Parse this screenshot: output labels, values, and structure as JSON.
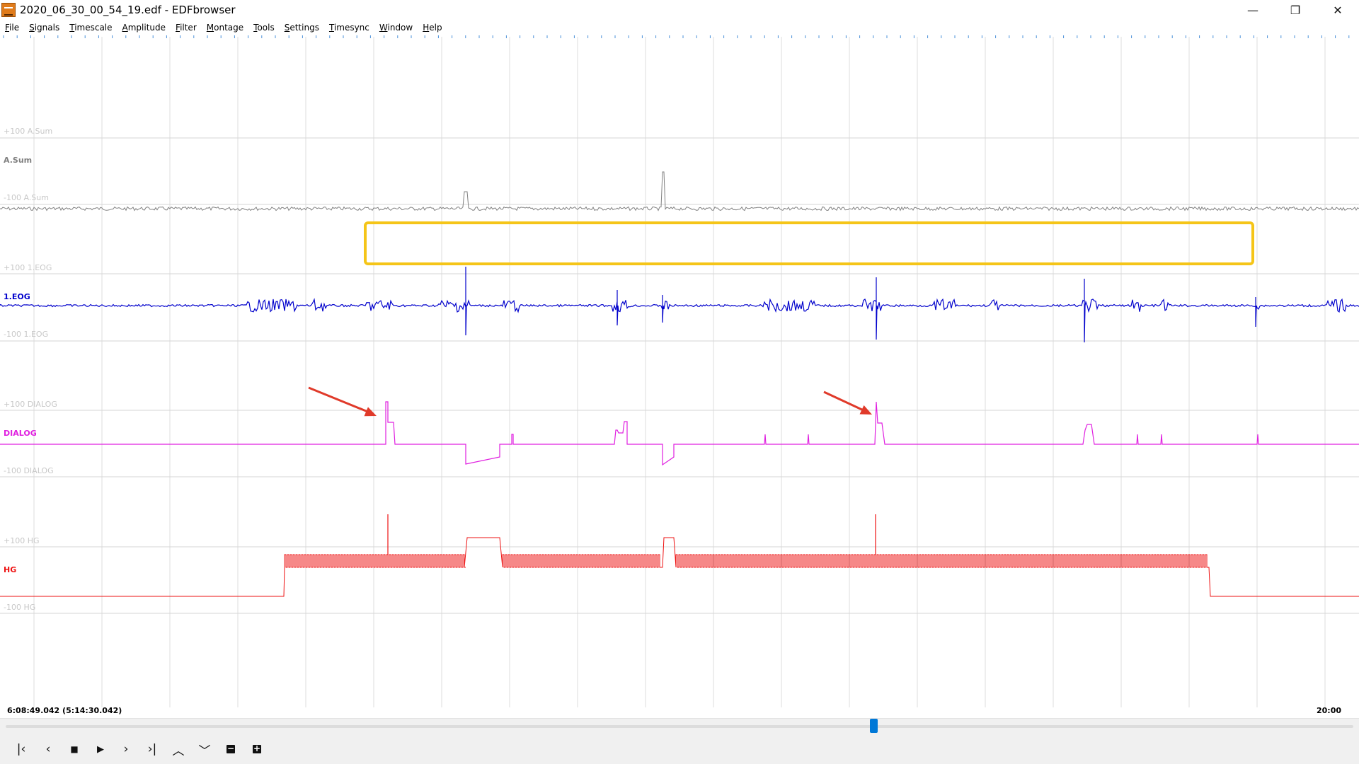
{
  "window": {
    "title": "2020_06_30_00_54_19.edf - EDFbrowser",
    "controls": {
      "minimize": "—",
      "maximize": "❐",
      "close": "✕"
    }
  },
  "menu": [
    "File",
    "Signals",
    "Timescale",
    "Amplitude",
    "Filter",
    "Montage",
    "Tools",
    "Settings",
    "Timesync",
    "Window",
    "Help"
  ],
  "signals": [
    {
      "id": "asum",
      "name": "A.Sum",
      "upper": "+100 A.Sum",
      "lower": "-100 A.Sum",
      "color": "#808080"
    },
    {
      "id": "eog",
      "name": "1.EOG",
      "upper": "+100 1.EOG",
      "lower": "-100 1.EOG",
      "color": "#0000cc"
    },
    {
      "id": "dialog",
      "name": "DIALOG",
      "upper": "+100 DIALOG",
      "lower": "-100 DIALOG",
      "color": "#e020e0"
    },
    {
      "id": "hg",
      "name": "HG",
      "upper": "+100 HG",
      "lower": "-100 HG",
      "color": "#ee1111"
    }
  ],
  "status": {
    "time_left": "6:08:49.042 (5:14:30.042)",
    "time_right": "20:00"
  },
  "scrollbar": {
    "position": 0.645
  },
  "navigation": [
    {
      "name": "first-page-button",
      "icon": "skip-start-icon",
      "glyph": "|‹"
    },
    {
      "name": "previous-button",
      "icon": "chevron-left-icon",
      "glyph": "‹"
    },
    {
      "name": "stop-button",
      "icon": "stop-icon",
      "glyph": "■"
    },
    {
      "name": "play-button",
      "icon": "play-icon",
      "glyph": "▶"
    },
    {
      "name": "next-button",
      "icon": "chevron-right-icon",
      "glyph": "›"
    },
    {
      "name": "last-page-button",
      "icon": "skip-end-icon",
      "glyph": "›|"
    },
    {
      "name": "amplitude-up-button",
      "icon": "chevron-up-icon",
      "glyph": "︿"
    },
    {
      "name": "amplitude-down-button",
      "icon": "chevron-down-icon",
      "glyph": "﹀"
    },
    {
      "name": "zoom-out-button",
      "icon": "minus-box-icon",
      "glyph": "−"
    },
    {
      "name": "zoom-in-button",
      "icon": "plus-box-icon",
      "glyph": "+"
    }
  ],
  "annotations": {
    "highlight_color": "#f5c518",
    "arrow_color": "#e03a2a"
  }
}
